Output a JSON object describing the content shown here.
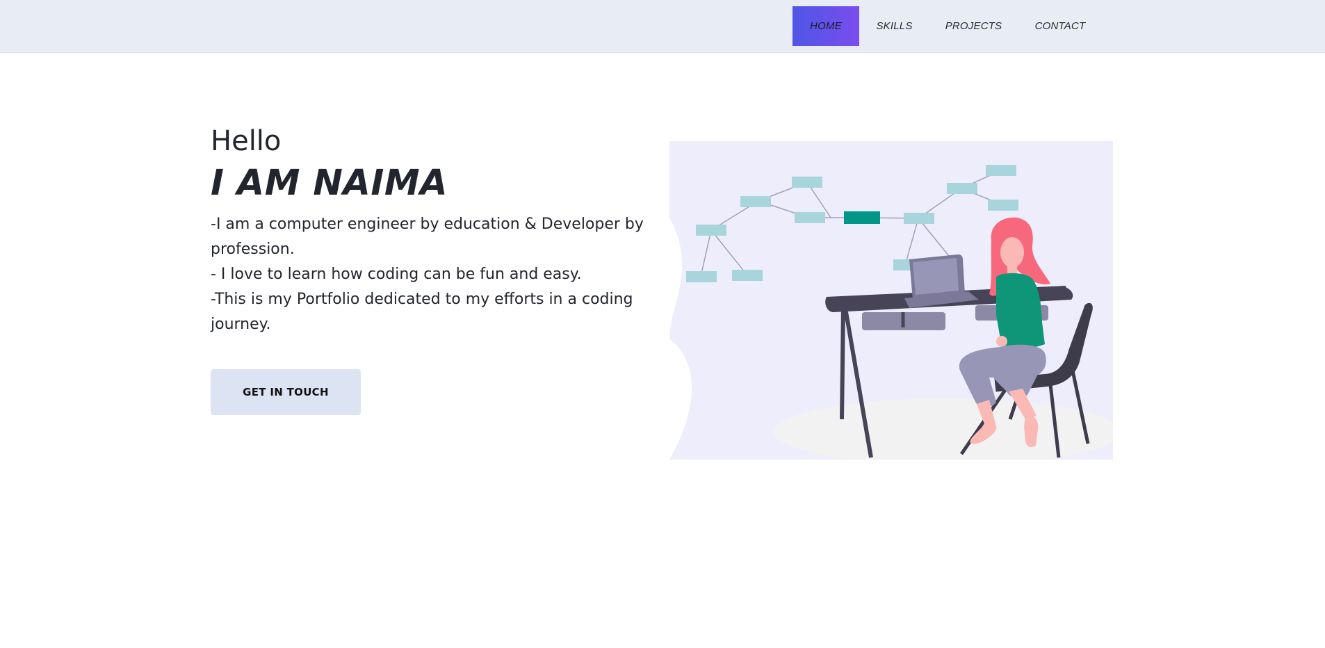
{
  "nav": {
    "items": [
      {
        "label": "HOME",
        "active": true
      },
      {
        "label": "SKILLS",
        "active": false
      },
      {
        "label": "PROJECTS",
        "active": false
      },
      {
        "label": "CONTACT",
        "active": false
      }
    ]
  },
  "hero": {
    "greeting": "Hello",
    "name": "I AM NAIMA",
    "bio": [
      "-I am a computer engineer by education & Developer by profession.",
      "- I love to learn how coding can be fun and easy.",
      "-This is my Portfolio dedicated to my efforts in a coding journey."
    ],
    "cta_label": "GET IN TOUCH"
  },
  "illustration": {
    "icon": "woman-at-desk-illustration",
    "colors": {
      "background": "#eeedfc",
      "node": "#a8d5dc",
      "node_active": "#009688",
      "desk": "#484457",
      "hair": "#f7687c",
      "shirt": "#0f9678",
      "pants": "#9896b6",
      "floor": "#f2f2f2"
    }
  },
  "colors": {
    "navbar_bg": "#e8ecf5",
    "active_gradient_start": "#4f56e6",
    "active_gradient_end": "#7a4dee",
    "cta_bg": "#dce3f2",
    "text": "#22252d"
  }
}
